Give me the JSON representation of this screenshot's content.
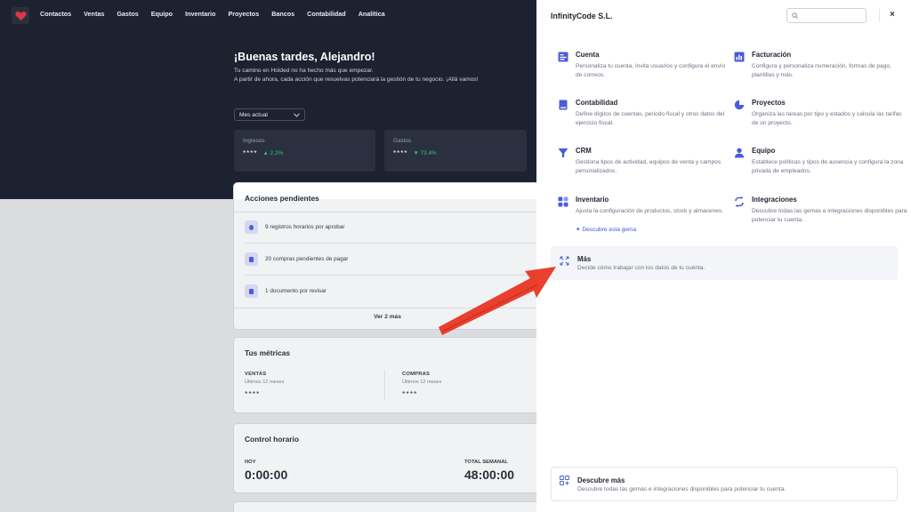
{
  "nav": [
    "Contactos",
    "Ventas",
    "Gastos",
    "Equipo",
    "Inventario",
    "Proyectos",
    "Bancos",
    "Contabilidad",
    "Analítica"
  ],
  "hero": {
    "greeting": "¡Buenas tardes, Alejandro!",
    "line1": "Tu camino en Holded no ha hecho más que empezar.",
    "line2": "A partir de ahora, cada acción que resuelvas potenciará la gestión de tu negocio. ¡Allá vamos!",
    "period": "Mes actual",
    "kpis": [
      {
        "label": "Ingresos",
        "value": "****",
        "delta": "▲ 2.2%"
      },
      {
        "label": "Gastos",
        "value": "****",
        "delta": "▼ 73.4%"
      }
    ]
  },
  "pending": {
    "title": "Acciones pendientes",
    "items": [
      "9 registros horarios por aprobar",
      "20 compras pendientes de pagar",
      "1 documento por revisar"
    ],
    "more": "Ver 2 más"
  },
  "metrics": {
    "title": "Tus métricas",
    "items": [
      {
        "label": "VENTAS",
        "sub": "Últimos 12 meses",
        "value": "****"
      },
      {
        "label": "COMPRAS",
        "sub": "Últimos 12 meses",
        "value": "****"
      }
    ]
  },
  "timeclock": {
    "title": "Control horario",
    "today_label": "HOY",
    "today_value": "0:00:00",
    "week_label": "TOTAL SEMANAL",
    "week_value": "48:00:00"
  },
  "panel": {
    "company": "InfinityCode S.L.",
    "search_placeholder": "",
    "close": "×",
    "options": [
      {
        "title": "Cuenta",
        "desc": "Personaliza tu cuenta, invita usuarios y configura el envío de correos.",
        "icon": "account-icon"
      },
      {
        "title": "Facturación",
        "desc": "Configura y personaliza numeración, formas de pago, plantillas y más.",
        "icon": "billing-icon"
      },
      {
        "title": "Contabilidad",
        "desc": "Define dígitos de cuentas, periodo fiscal y otros datos del ejercicio fiscal.",
        "icon": "accounting-icon"
      },
      {
        "title": "Proyectos",
        "desc": "Organiza las tareas por tipo y estados y calcula las tarifas de un proyecto.",
        "icon": "projects-icon"
      },
      {
        "title": "CRM",
        "desc": "Gestiona tipos de actividad, equipos de venta y campos personalizados.",
        "icon": "crm-icon"
      },
      {
        "title": "Equipo",
        "desc": "Establece políticas y tipos de ausencia y configura la zona privada de empleados.",
        "icon": "team-icon"
      },
      {
        "title": "Inventario",
        "desc": "Ajusta la configuración de productos, stock y almacenes.",
        "icon": "inventory-icon"
      },
      {
        "title": "Integraciones",
        "desc": "Descubre todas las gemas e integraciones disponibles para potenciar tu cuenta.",
        "icon": "integrations-icon"
      }
    ],
    "gem_link": "Descubre esta gema",
    "more": {
      "title": "Más",
      "desc": "Decide cómo trabajar con los datos de tu cuenta."
    },
    "discover": {
      "title": "Descubre más",
      "desc": "Descubre todas las gemas e integraciones disponibles para potenciar tu cuenta."
    }
  },
  "colors": {
    "accent": "#4a5bdc",
    "dark_bg": "#1d2230",
    "annotation": "#e8301c",
    "positive": "#35c37a"
  }
}
